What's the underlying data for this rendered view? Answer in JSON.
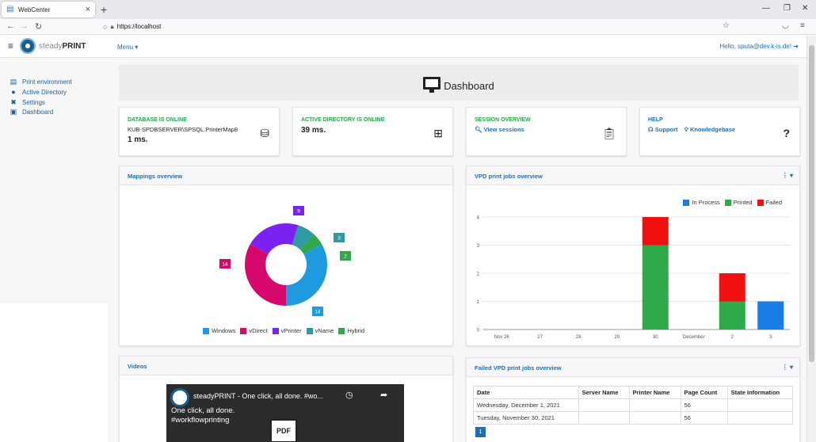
{
  "browser": {
    "tab_title": "WebCenter",
    "url": "https://localhost"
  },
  "app": {
    "brand_light": "steady",
    "brand_bold": "PRINT",
    "menu_label": "Menu ▾",
    "greeting": "Hello, sputa@dev.k-is.de!"
  },
  "sidebar": {
    "items": [
      {
        "label": "Print environment",
        "icon": "printer-icon"
      },
      {
        "label": "Active Directory",
        "icon": "user-icon"
      },
      {
        "label": "Settings",
        "icon": "tools-icon"
      },
      {
        "label": "Dashboard",
        "icon": "monitor-icon"
      }
    ]
  },
  "dashboard_title": "Dashboard",
  "cards": {
    "database": {
      "heading": "DATABASE IS ONLINE",
      "server": "KUB-SPDBSERVER\\SPSQL.PrinterMap8",
      "latency": "1 ms."
    },
    "ad": {
      "heading": "ACTIVE DIRECTORY IS ONLINE",
      "latency": "39 ms."
    },
    "session": {
      "heading": "SESSION OVERVIEW",
      "link": "View sessions"
    },
    "help": {
      "heading": "HELP",
      "support": "Support",
      "kb": "Knowledgebase"
    }
  },
  "mappings": {
    "title": "Mappings overview",
    "chart_data": {
      "type": "pie",
      "labels": [
        "Windows",
        "vDirect",
        "vPrinter",
        "vName",
        "Hybrid"
      ],
      "values": [
        14,
        14,
        9,
        3,
        2
      ],
      "colors": [
        "#1e9bdf",
        "#d6086d",
        "#7b21f0",
        "#2f9aa3",
        "#2fa84f"
      ]
    }
  },
  "vpd": {
    "title": "VPD print jobs overview",
    "chart_data": {
      "type": "bar",
      "categories": [
        "Nov 26",
        "27",
        "28",
        "29",
        "30",
        "December",
        "2",
        "3"
      ],
      "series": [
        {
          "name": "In Process",
          "color": "#1a7de6",
          "values": [
            0,
            0,
            0,
            0,
            0,
            0,
            0,
            1
          ]
        },
        {
          "name": "Printed",
          "color": "#2faa4a",
          "values": [
            0,
            0,
            0,
            0,
            3,
            0,
            1,
            0
          ]
        },
        {
          "name": "Failed",
          "color": "#f01010",
          "values": [
            0,
            0,
            0,
            0,
            1,
            0,
            1,
            0
          ]
        }
      ],
      "ylim": [
        0,
        4
      ],
      "yticks": [
        "0",
        "1",
        "2",
        "3",
        "4"
      ]
    }
  },
  "videos": {
    "title": "Videos",
    "video_title": "steadyPRINT - One click, all done. #wo...",
    "overlay_line1": "One click, all done.",
    "overlay_line2": "#workflowprinting",
    "pdf": "PDF"
  },
  "failed": {
    "title": "Failed VPD print jobs overview",
    "headers": [
      "Date",
      "Server Name",
      "Printer Name",
      "Page Count",
      "State Information"
    ],
    "rows": [
      [
        "Wednesday, December 1, 2021",
        "",
        "",
        "56",
        ""
      ],
      [
        "Tuesday, November 30, 2021",
        "",
        "",
        "56",
        ""
      ]
    ],
    "page": "1"
  }
}
